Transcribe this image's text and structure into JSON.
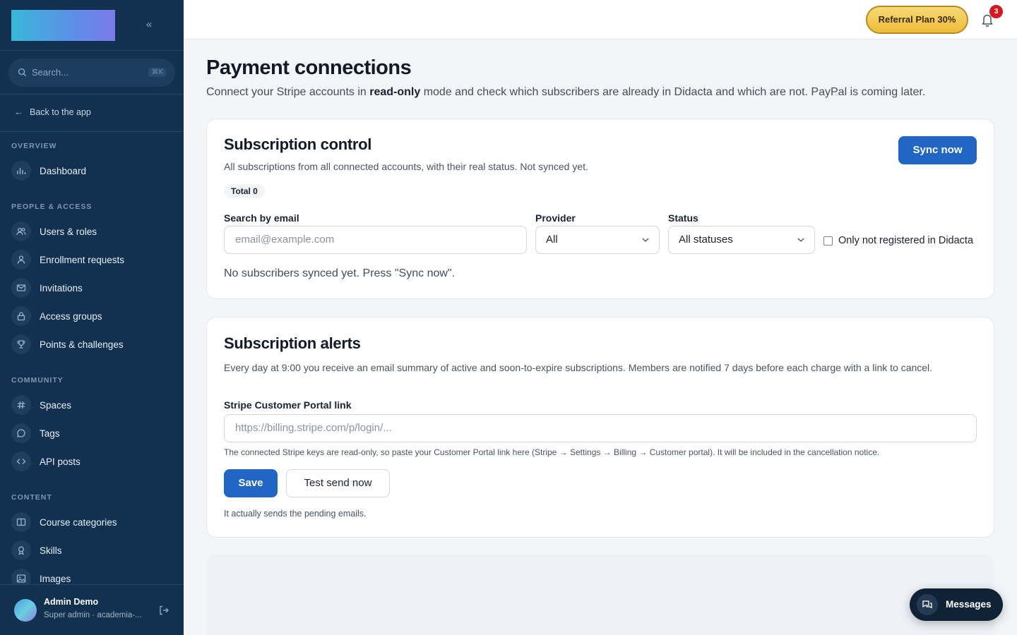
{
  "sidebar": {
    "collapse_icon": "chevrons-left-icon",
    "search_placeholder": "Search...",
    "search_shortcut": "⌘K",
    "back_label": "Back to the app",
    "sections": [
      {
        "title": "OVERVIEW",
        "items": [
          {
            "label": "Dashboard",
            "icon": "bar-chart-icon"
          }
        ]
      },
      {
        "title": "PEOPLE & ACCESS",
        "items": [
          {
            "label": "Users & roles",
            "icon": "users-icon"
          },
          {
            "label": "Enrollment requests",
            "icon": "user-icon"
          },
          {
            "label": "Invitations",
            "icon": "mail-icon"
          },
          {
            "label": "Access groups",
            "icon": "lock-icon"
          },
          {
            "label": "Points & challenges",
            "icon": "trophy-icon"
          }
        ]
      },
      {
        "title": "COMMUNITY",
        "items": [
          {
            "label": "Spaces",
            "icon": "hash-icon"
          },
          {
            "label": "Tags",
            "icon": "chat-bubble-icon"
          },
          {
            "label": "API posts",
            "icon": "code-icon"
          }
        ]
      },
      {
        "title": "CONTENT",
        "items": [
          {
            "label": "Course categories",
            "icon": "book-open-icon"
          },
          {
            "label": "Skills",
            "icon": "award-icon"
          },
          {
            "label": "Images",
            "icon": "image-icon"
          }
        ]
      }
    ],
    "user": {
      "name": "Admin Demo",
      "role": "Super admin · academia-..."
    }
  },
  "topbar": {
    "referral_label": "Referral Plan 30%",
    "notification_count": "3"
  },
  "page": {
    "title": "Payment connections",
    "subtitle_before": "Connect your Stripe accounts in ",
    "subtitle_bold": "read-only",
    "subtitle_after": " mode and check which subscribers are already in Didacta and which are not. PayPal is coming later."
  },
  "control": {
    "title": "Subscription control",
    "subtitle": "All subscriptions from all connected accounts, with their real status. Not synced yet.",
    "sync_label": "Sync now",
    "total_label": "Total 0",
    "email_label": "Search by email",
    "email_placeholder": "email@example.com",
    "provider_label": "Provider",
    "provider_value": "All",
    "status_label": "Status",
    "status_value": "All statuses",
    "checkbox_label": "Only not registered in Didacta",
    "empty_text": "No subscribers synced yet. Press \"Sync now\"."
  },
  "alerts": {
    "title": "Subscription alerts",
    "description": "Every day at 9:00 you receive an email summary of active and soon-to-expire subscriptions. Members are notified 7 days before each charge with a link to cancel.",
    "portal_label": "Stripe Customer Portal link",
    "portal_placeholder": "https://billing.stripe.com/p/login/...",
    "help_text": "The connected Stripe keys are read-only, so paste your Customer Portal link here (Stripe → Settings → Billing → Customer portal). It will be included in the cancellation notice.",
    "save_label": "Save",
    "test_label": "Test send now",
    "note": "It actually sends the pending emails."
  },
  "messages": {
    "label": "Messages"
  }
}
